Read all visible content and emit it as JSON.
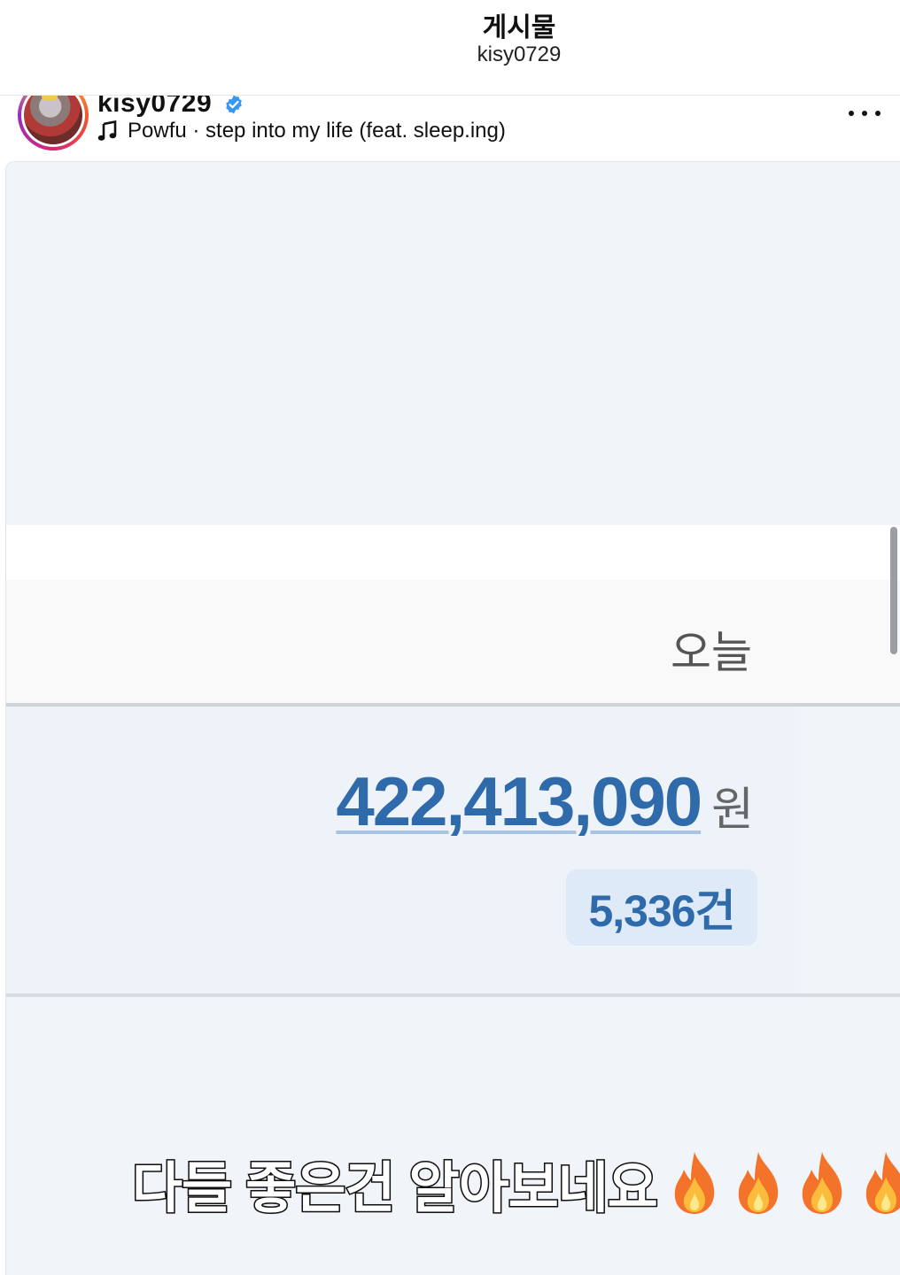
{
  "nav": {
    "title": "게시물",
    "subtitle": "kisy0729"
  },
  "post": {
    "username": "kisy0729",
    "verified": true,
    "music": "Powfu · step into my life (feat. sleep.ing)"
  },
  "content": {
    "date_label": "오늘",
    "amount": "422,413,090",
    "amount_unit": "원",
    "count": "5,336건",
    "caption": "다들 좋은건 알아보네요",
    "caption_emoji_count": 4
  },
  "colors": {
    "accent_blue": "#2f6aaa",
    "verified_blue": "#3897f0",
    "badge_bg": "#dfeaf8",
    "fire_orange": "#f4732a"
  },
  "icons": {
    "verified": "verified-badge-icon",
    "music": "music-note-icon",
    "more": "more-options-icon",
    "fire": "fire-emoji-icon"
  }
}
